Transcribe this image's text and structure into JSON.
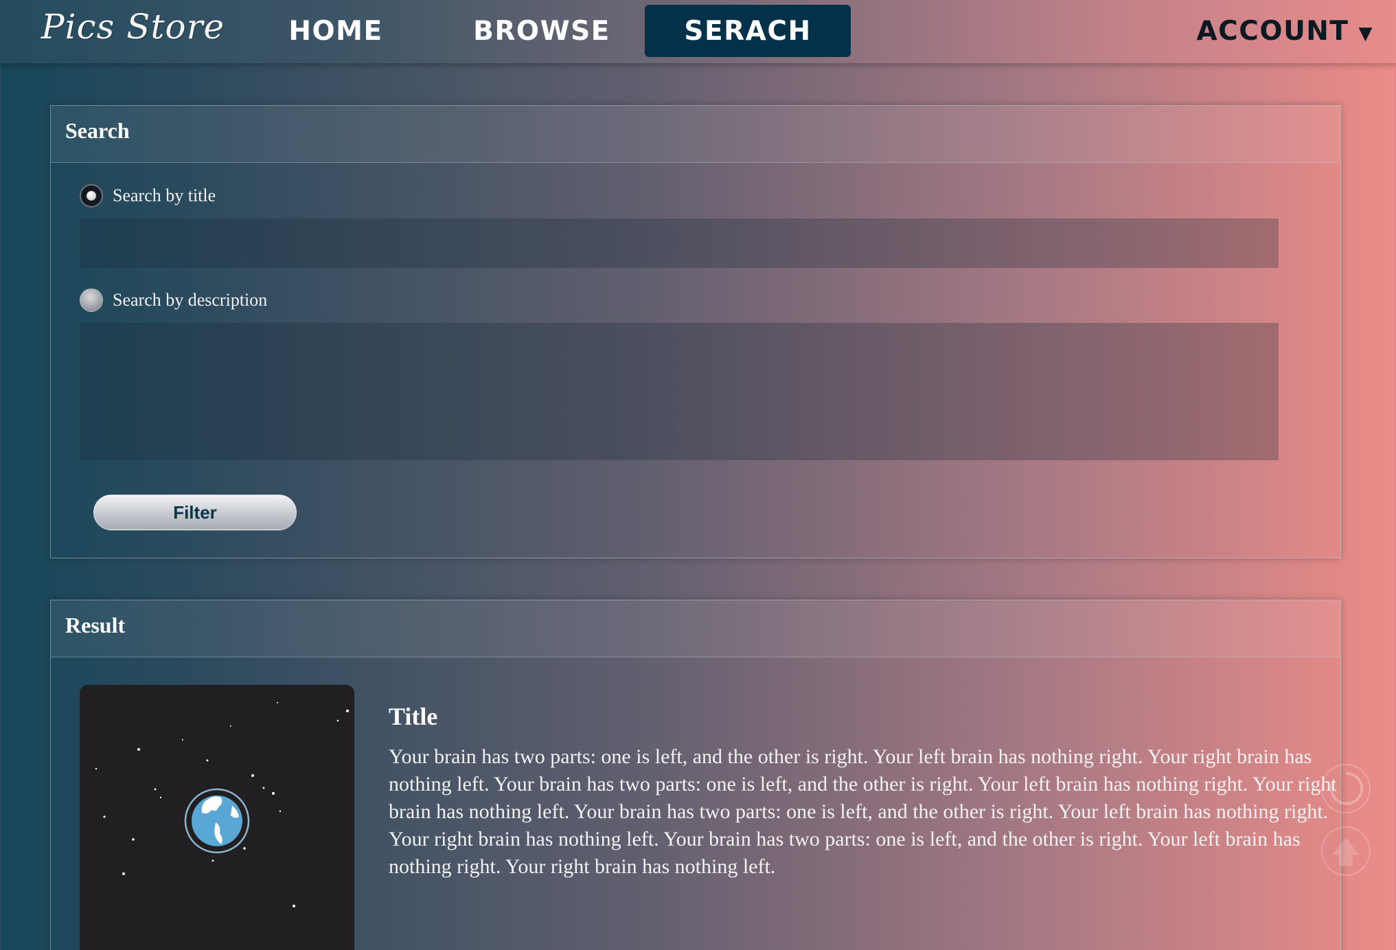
{
  "nav": {
    "logo": "Pics Store",
    "items": [
      {
        "label": "HOME",
        "active": false
      },
      {
        "label": "BROWSE",
        "active": false
      },
      {
        "label": "SERACH",
        "active": true
      }
    ],
    "account": {
      "label": "ACCOUNT",
      "caret": "▼"
    }
  },
  "search": {
    "header": "Search",
    "option_title": {
      "label": "Search by title",
      "checked": true,
      "value": ""
    },
    "option_description": {
      "label": "Search by description",
      "checked": false,
      "value": ""
    },
    "filter_label": "Filter"
  },
  "result": {
    "header": "Result",
    "items": [
      {
        "image_icon": "earth-in-space",
        "title": "Title",
        "description": "Your brain has two parts: one is left, and the other is right. Your left brain has nothing right. Your right brain has nothing left. Your brain has two parts: one is left, and the other is right. Your left brain has nothing right. Your right brain has nothing left. Your brain has two parts: one is left, and the other is right. Your left brain has nothing right. Your right brain has nothing left. Your brain has two parts: one is left, and the other is right. Your left brain has nothing right. Your right brain has nothing left."
      }
    ]
  },
  "floating": {
    "refresh_icon": "refresh-icon",
    "top_icon": "arrow-up-icon"
  },
  "colors": {
    "nav_active": "#04314a",
    "gradient_start": "#17475a",
    "gradient_end": "#ed8c88",
    "thumb_bg": "#221f22",
    "earth": "#5aa7d6"
  }
}
